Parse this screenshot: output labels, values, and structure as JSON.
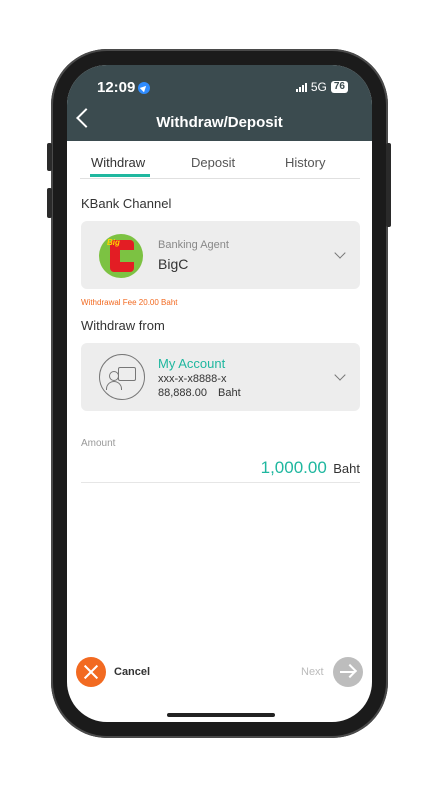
{
  "status": {
    "time": "12:09",
    "network": "5G",
    "battery": "76"
  },
  "header": {
    "title": "Withdraw/Deposit"
  },
  "tabs": [
    {
      "label": "Withdraw",
      "active": true
    },
    {
      "label": "Deposit",
      "active": false
    },
    {
      "label": "History",
      "active": false
    }
  ],
  "channel": {
    "section_label": "KBank Channel",
    "type_label": "Banking Agent",
    "name": "BigC",
    "logo_text": "Big",
    "fee_text": "Withdrawal Fee 20.00  Baht"
  },
  "withdraw_from": {
    "section_label": "Withdraw from",
    "account_name": "My Account",
    "account_number": "xxx-x-x8888-x",
    "balance": "88,888.00",
    "currency": "Baht"
  },
  "amount": {
    "label": "Amount",
    "value": "1,000.00",
    "currency": "Baht"
  },
  "footer": {
    "cancel_label": "Cancel",
    "next_label": "Next"
  },
  "colors": {
    "header_bg": "#3b4b4f",
    "accent": "#1fb79f",
    "fee_orange": "#f26a21",
    "cancel": "#f26a21"
  }
}
